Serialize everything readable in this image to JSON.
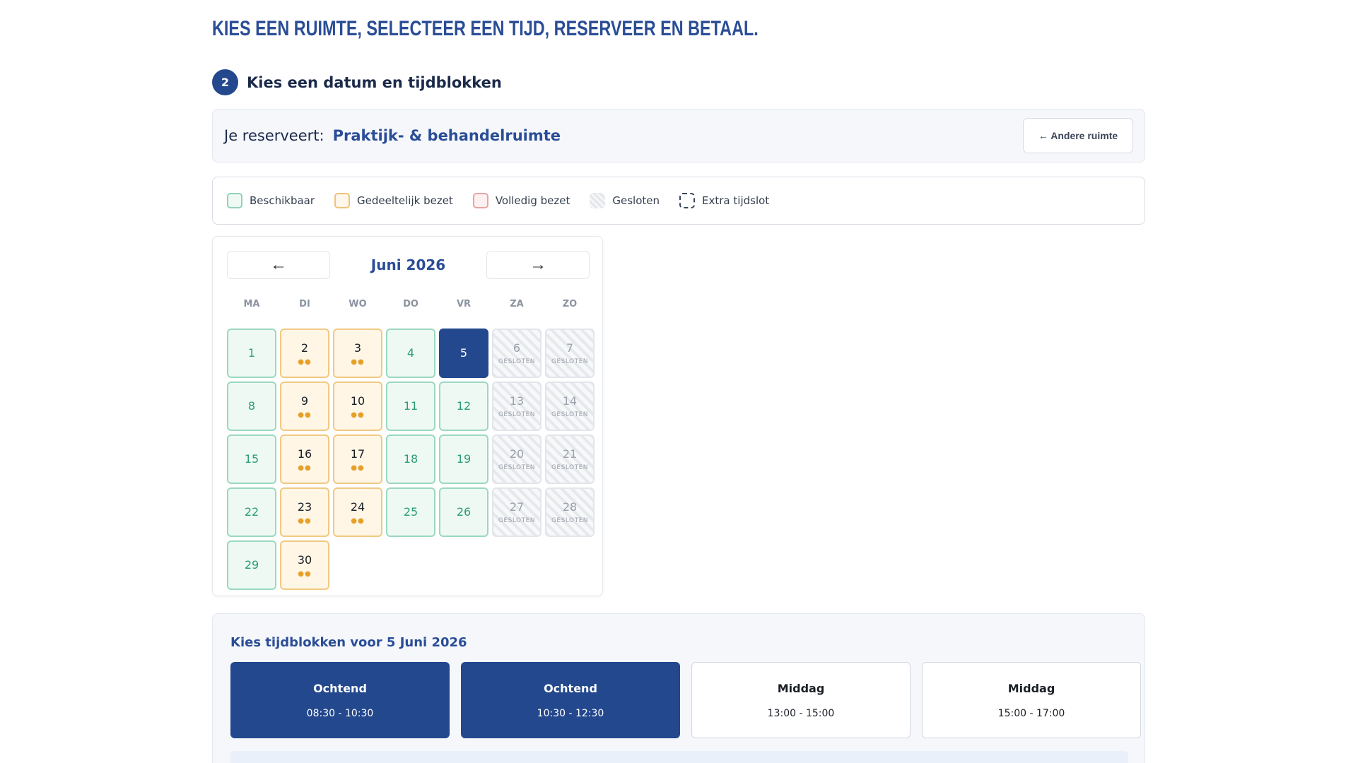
{
  "page": {
    "title": "Kies een ruimte, selecteer een tijd, reserveer en betaal."
  },
  "step": {
    "number": "2",
    "title": "Kies een datum en tijdblokken"
  },
  "reservation": {
    "label": "Je reserveert:",
    "room": "Praktijk- & behandelruimte",
    "other_room_button": "← Andere ruimte"
  },
  "legend": [
    {
      "label": "Beschikbaar",
      "kind": "available"
    },
    {
      "label": "Gedeeltelijk bezet",
      "kind": "partial"
    },
    {
      "label": "Volledig bezet",
      "kind": "full"
    },
    {
      "label": "Gesloten",
      "kind": "closed"
    },
    {
      "label": "Extra tijdslot",
      "kind": "extra"
    }
  ],
  "calendar": {
    "prev_label": "←",
    "next_label": "→",
    "month": "Juni 2026",
    "weekdays": [
      "MA",
      "DI",
      "WO",
      "DO",
      "VR",
      "ZA",
      "ZO"
    ],
    "closed_label": "GESLOTEN",
    "dots": "●●",
    "days": [
      {
        "day": "1",
        "status": "available"
      },
      {
        "day": "2",
        "status": "partial"
      },
      {
        "day": "3",
        "status": "partial"
      },
      {
        "day": "4",
        "status": "available"
      },
      {
        "day": "5",
        "status": "selected"
      },
      {
        "day": "6",
        "status": "closed"
      },
      {
        "day": "7",
        "status": "closed"
      },
      {
        "day": "8",
        "status": "available"
      },
      {
        "day": "9",
        "status": "partial"
      },
      {
        "day": "10",
        "status": "partial"
      },
      {
        "day": "11",
        "status": "available"
      },
      {
        "day": "12",
        "status": "available"
      },
      {
        "day": "13",
        "status": "closed"
      },
      {
        "day": "14",
        "status": "closed"
      },
      {
        "day": "15",
        "status": "available"
      },
      {
        "day": "16",
        "status": "partial"
      },
      {
        "day": "17",
        "status": "partial"
      },
      {
        "day": "18",
        "status": "available"
      },
      {
        "day": "19",
        "status": "available"
      },
      {
        "day": "20",
        "status": "closed"
      },
      {
        "day": "21",
        "status": "closed"
      },
      {
        "day": "22",
        "status": "available"
      },
      {
        "day": "23",
        "status": "partial"
      },
      {
        "day": "24",
        "status": "partial"
      },
      {
        "day": "25",
        "status": "available"
      },
      {
        "day": "26",
        "status": "available"
      },
      {
        "day": "27",
        "status": "closed"
      },
      {
        "day": "28",
        "status": "closed"
      },
      {
        "day": "29",
        "status": "available"
      },
      {
        "day": "30",
        "status": "partial"
      }
    ]
  },
  "timeblocks": {
    "title": "Kies tijdblokken voor 5 Juni 2026",
    "slots": [
      {
        "name": "Ochtend",
        "time": "08:30 - 10:30",
        "selected": true
      },
      {
        "name": "Ochtend",
        "time": "10:30 - 12:30",
        "selected": true
      },
      {
        "name": "Middag",
        "time": "13:00 - 15:00",
        "selected": false
      },
      {
        "name": "Middag",
        "time": "15:00 - 17:00",
        "selected": false
      }
    ]
  },
  "colors": {
    "primary": "#23488e",
    "heading": "#2a4d96",
    "available": "#9bd9bf",
    "partial": "#f0c982",
    "full": "#eba3a3"
  }
}
